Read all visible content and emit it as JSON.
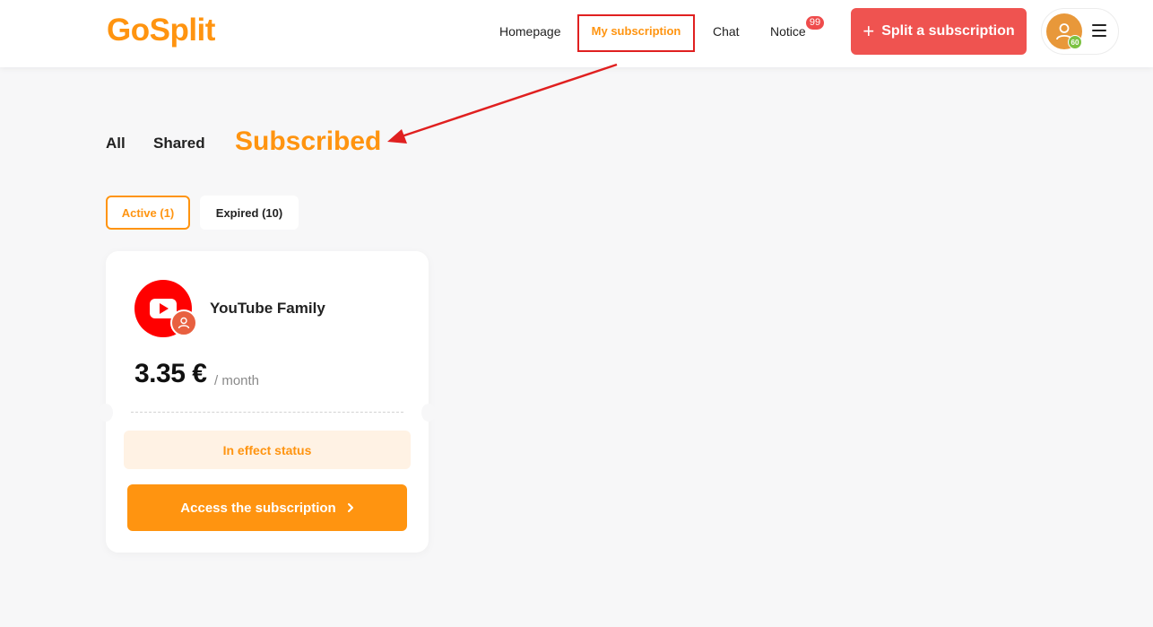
{
  "header": {
    "logo": "GoSplit",
    "nav": {
      "homepage": "Homepage",
      "my_subscription": "My subscription",
      "chat": "Chat",
      "notice": "Notice",
      "notice_count": "99"
    },
    "split_button": "Split a subscription",
    "user": {
      "level": "60"
    }
  },
  "tabs": {
    "all": "All",
    "shared": "Shared",
    "subscribed": "Subscribed"
  },
  "filters": {
    "active": "Active (1)",
    "expired": "Expired (10)"
  },
  "subscriptions": [
    {
      "service": "YouTube Family",
      "price": "3.35 €",
      "period": "/ month",
      "status": "In effect status",
      "action": "Access the subscription"
    }
  ],
  "colors": {
    "brand_orange": "#ff9410",
    "split_red": "#ef5350",
    "annotation_red": "#e02020",
    "youtube_red": "#ff0000"
  },
  "icons": [
    "plus-icon",
    "user-icon",
    "menu-icon",
    "youtube-icon",
    "owner-icon",
    "chevron-right-icon"
  ]
}
